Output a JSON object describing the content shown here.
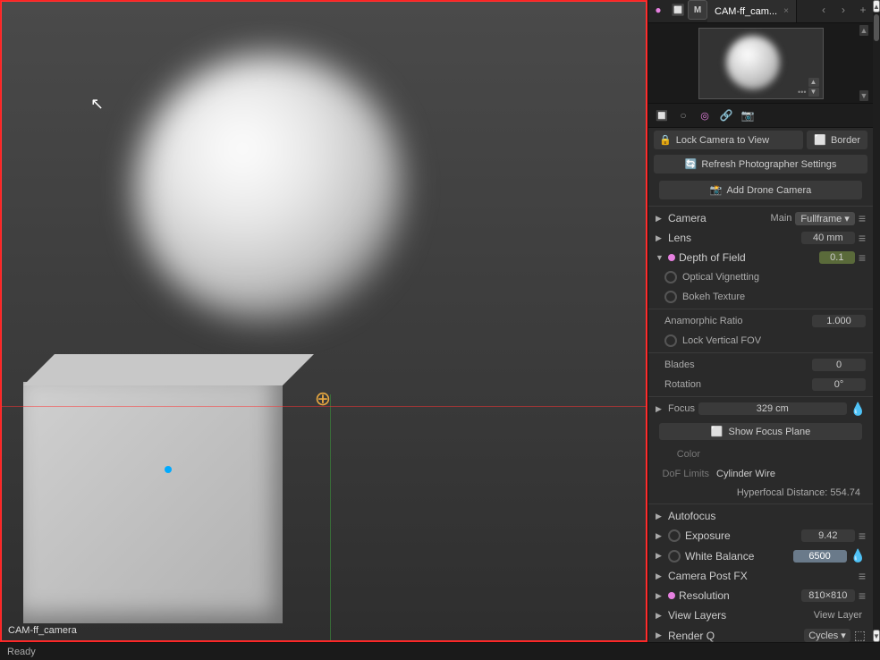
{
  "viewport": {
    "label": "CAM-ff_camera"
  },
  "panel": {
    "tab_title": "CAM-ff_cam...",
    "tab_close": "×",
    "tab_plus": "+",
    "icons": [
      "📷",
      "🎬",
      "📹",
      "🎥",
      "📊"
    ],
    "buttons": {
      "lock_camera": "Lock Camera to View",
      "refresh_photographer": "Refresh Photographer Settings",
      "add_drone": "Add Drone Camera",
      "border": "Border",
      "show_focus_plane": "Show Focus Plane"
    },
    "sections": {
      "camera": {
        "label": "Camera",
        "preset": "Main",
        "type": "Fullframe",
        "arrow": "▶"
      },
      "lens": {
        "label": "Lens",
        "value": "40 mm",
        "arrow": "▶"
      },
      "depth_of_field": {
        "label": "Depth of Field",
        "value": "0.1",
        "arrow": "▼",
        "active": true
      },
      "optical_vignetting": {
        "label": "Optical Vignetting"
      },
      "bokeh_texture": {
        "label": "Bokeh Texture"
      },
      "anamorphic_ratio": {
        "label": "Anamorphic Ratio",
        "value": "1.000"
      },
      "lock_vertical_fov": {
        "label": "Lock Vertical FOV"
      },
      "blades": {
        "label": "Blades",
        "value": "0"
      },
      "rotation": {
        "label": "Rotation",
        "value": "0°"
      },
      "focus": {
        "label": "Focus",
        "value": "329 cm",
        "arrow": "▶"
      },
      "color_label": "Color",
      "dof_limits_label": "DoF Limits",
      "dof_limits_value": "Cylinder Wire",
      "hyperfocal": "Hyperfocal Distance: 554.74",
      "autofocus": {
        "label": "Autofocus",
        "arrow": "▶"
      },
      "exposure": {
        "label": "Exposure",
        "value": "9.42",
        "arrow": "▶"
      },
      "white_balance": {
        "label": "White Balance",
        "value": "6500",
        "arrow": "▶"
      },
      "camera_post_fx": {
        "label": "Camera Post FX",
        "arrow": "▶"
      },
      "resolution": {
        "label": "Resolution",
        "value": "810×810",
        "arrow": "▶"
      },
      "view_layers": {
        "label": "View Layers",
        "value": "View Layer",
        "arrow": "▶"
      },
      "render_q": {
        "label": "Render Q",
        "value": "Cycles",
        "arrow": "▶"
      }
    }
  },
  "scrollbar": {
    "up_arrow": "▲",
    "down_arrow": "▼"
  }
}
